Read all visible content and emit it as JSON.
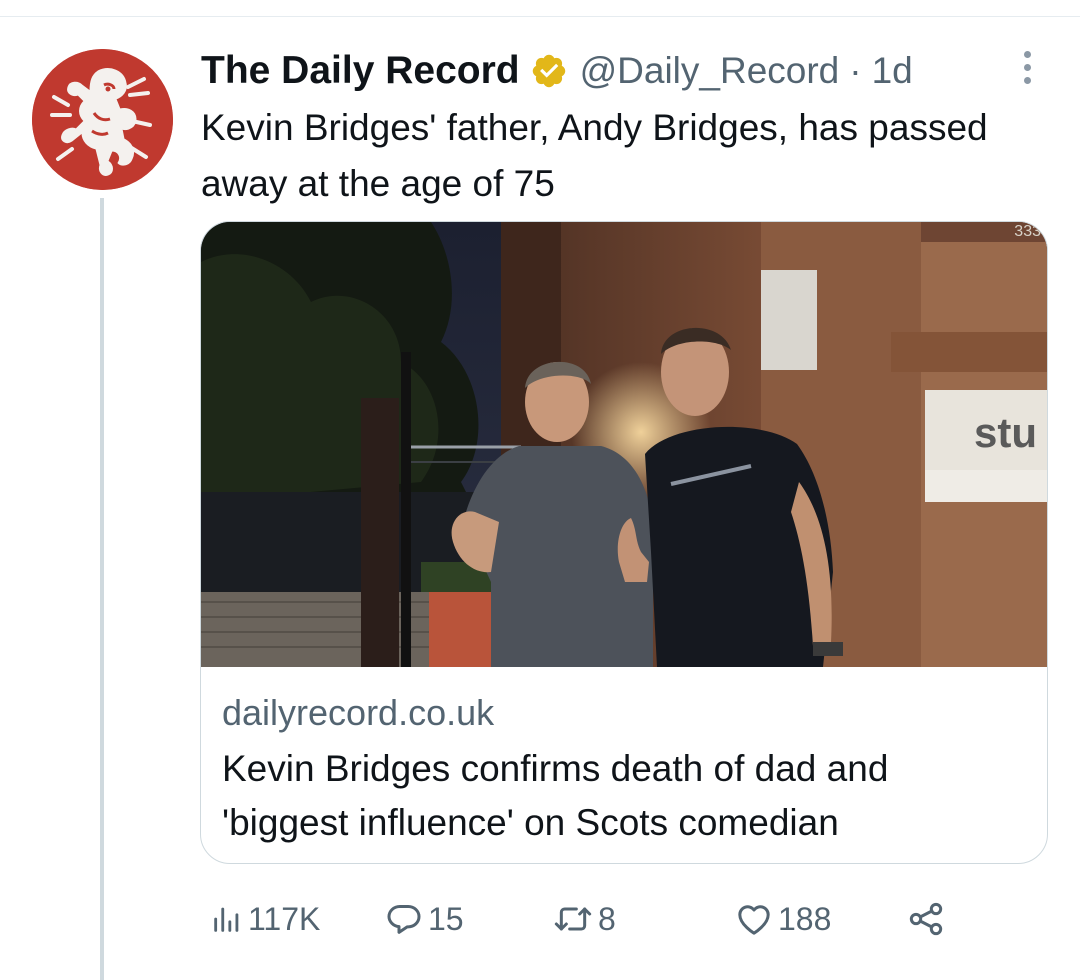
{
  "tweet": {
    "author": {
      "display_name": "The Daily Record",
      "handle": "@Daily_Record",
      "separator": "·",
      "time": "1d"
    },
    "text": "Kevin Bridges' father, Andy Bridges, has passed away at the age of 75",
    "card": {
      "domain": "dailyrecord.co.uk",
      "title": "Kevin Bridges confirms death of dad and 'biggest influence' on Scots comedian",
      "image_sign_text": "stu",
      "image_building_number": "333"
    },
    "stats": {
      "views": "117K",
      "replies": "15",
      "retweets": "8",
      "likes": "188"
    }
  },
  "colors": {
    "avatar_bg": "#c0392f",
    "verified_badge": "#e2b719",
    "secondary_text": "#536471",
    "thread_line": "#cfd9de"
  },
  "icons": {
    "verified": "verified-badge-icon",
    "more": "more-options-icon",
    "views": "views-bar-chart-icon",
    "reply": "reply-bubble-icon",
    "retweet": "retweet-icon",
    "like": "heart-icon",
    "share": "share-icon"
  }
}
